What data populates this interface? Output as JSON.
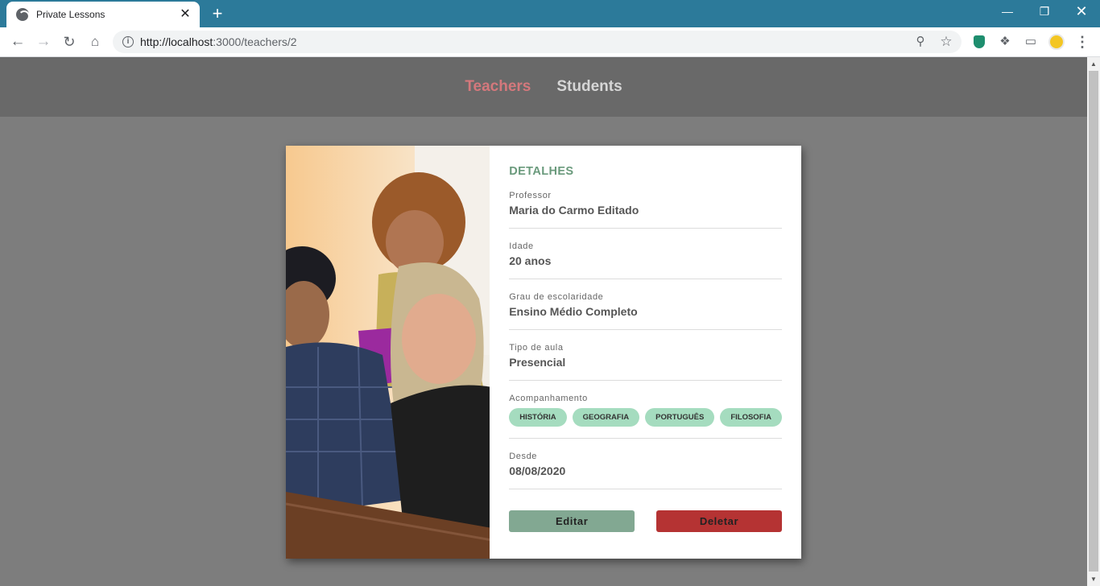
{
  "browser": {
    "tab_title": "Private Lessons",
    "tab_close": "✕",
    "new_tab": "+",
    "url_host": "http://localhost",
    "url_rest": ":3000/teachers/2",
    "window_min": "—",
    "window_max": "❐",
    "window_close": "✕"
  },
  "nav": {
    "teachers": "Teachers",
    "students": "Students",
    "active_color": "#d4787c"
  },
  "details": {
    "heading": "DETALHES",
    "fields": [
      {
        "label": "Professor",
        "value": "Maria do Carmo Editado"
      },
      {
        "label": "Idade",
        "value": "20 anos"
      },
      {
        "label": "Grau de escolaridade",
        "value": "Ensino Médio Completo"
      },
      {
        "label": "Tipo de aula",
        "value": "Presencial"
      }
    ],
    "subjects_label": "Acompanhamento",
    "subjects": [
      "HISTÓRIA",
      "GEOGRAFIA",
      "PORTUGUÊS",
      "FILOSOFIA"
    ],
    "since_label": "Desde",
    "since_value": "08/08/2020"
  },
  "actions": {
    "edit": "Editar",
    "delete": "Deletar",
    "edit_color": "#82a892",
    "delete_color": "#b53333"
  }
}
